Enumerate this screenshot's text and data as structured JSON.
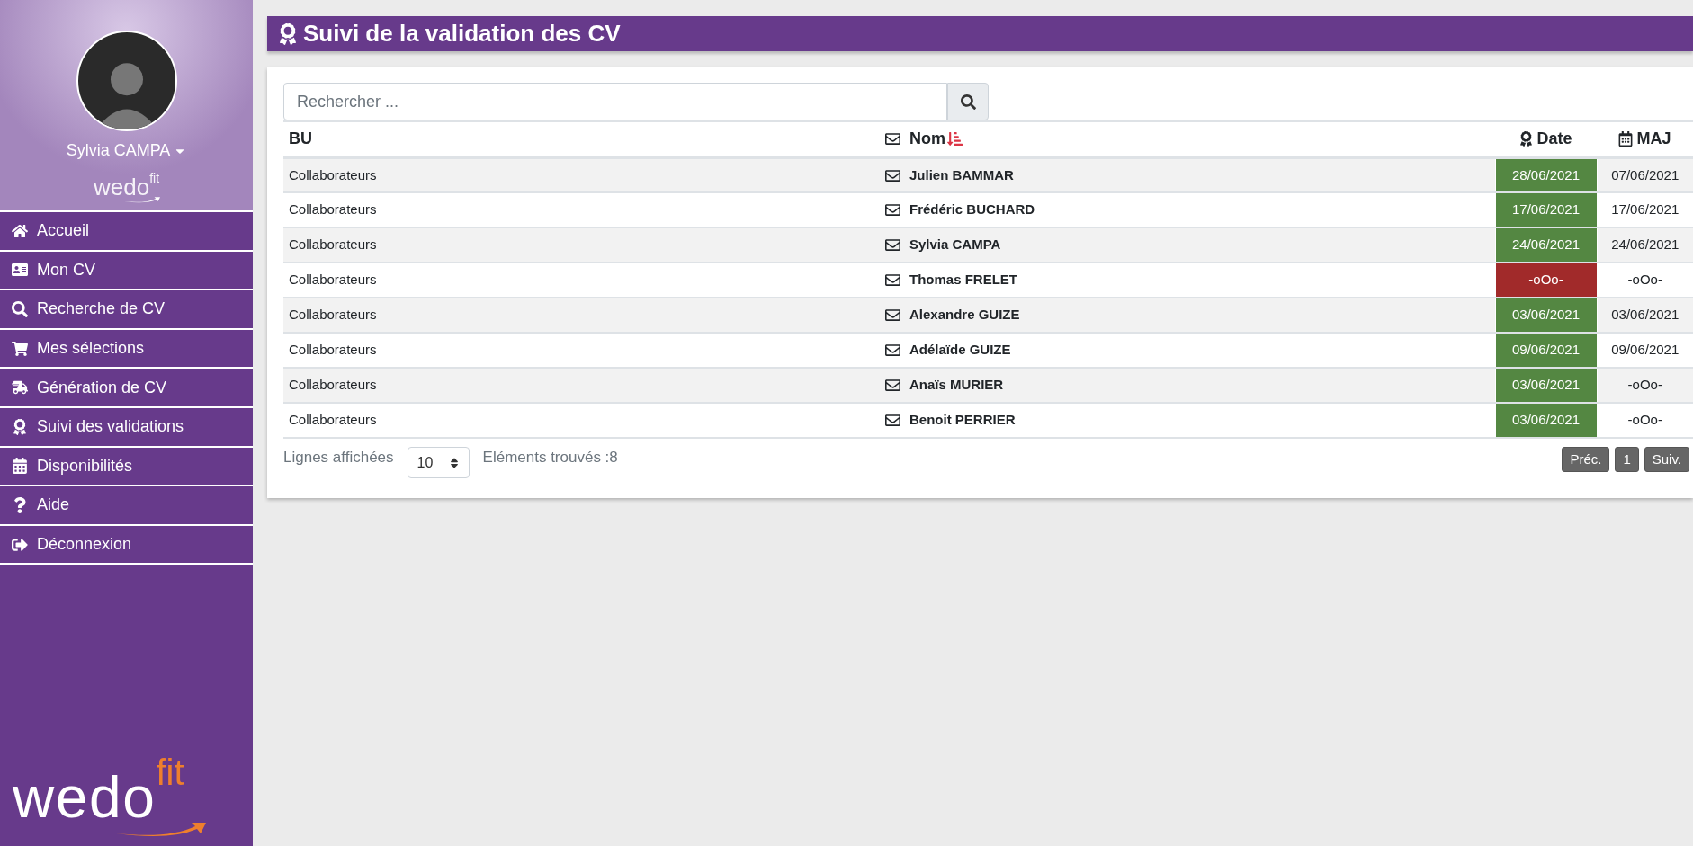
{
  "sidebar": {
    "user": {
      "name": "Sylvia CAMPA"
    },
    "logo_small": {
      "main": "wedo",
      "accent": "fit"
    },
    "items": [
      {
        "label": "Accueil"
      },
      {
        "label": "Mon CV"
      },
      {
        "label": "Recherche de CV"
      },
      {
        "label": "Mes sélections"
      },
      {
        "label": "Génération de CV"
      },
      {
        "label": "Suivi des validations"
      },
      {
        "label": "Disponibilités"
      },
      {
        "label": "Aide"
      },
      {
        "label": "Déconnexion"
      }
    ],
    "logo_large": {
      "main": "wedo",
      "accent": "fit"
    }
  },
  "page": {
    "title": "Suivi de la validation des CV"
  },
  "search": {
    "placeholder": "Rechercher ..."
  },
  "table": {
    "columns": [
      "BU",
      "Nom",
      "Date",
      "MAJ"
    ],
    "rows": [
      {
        "bu": "Collaborateurs",
        "nom": "Julien BAMMAR",
        "date": "28/06/2021",
        "validated": true,
        "maj": "07/06/2021"
      },
      {
        "bu": "Collaborateurs",
        "nom": "Frédéric BUCHARD",
        "date": "17/06/2021",
        "validated": true,
        "maj": "17/06/2021"
      },
      {
        "bu": "Collaborateurs",
        "nom": "Sylvia CAMPA",
        "date": "24/06/2021",
        "validated": true,
        "maj": "24/06/2021"
      },
      {
        "bu": "Collaborateurs",
        "nom": "Thomas FRELET",
        "date": "-oOo-",
        "validated": false,
        "maj": "-oOo-"
      },
      {
        "bu": "Collaborateurs",
        "nom": "Alexandre GUIZE",
        "date": "03/06/2021",
        "validated": true,
        "maj": "03/06/2021"
      },
      {
        "bu": "Collaborateurs",
        "nom": "Adélaïde GUIZE",
        "date": "09/06/2021",
        "validated": true,
        "maj": "09/06/2021"
      },
      {
        "bu": "Collaborateurs",
        "nom": "Anaïs MURIER",
        "date": "03/06/2021",
        "validated": true,
        "maj": "-oOo-"
      },
      {
        "bu": "Collaborateurs",
        "nom": "Benoit PERRIER",
        "date": "03/06/2021",
        "validated": true,
        "maj": "-oOo-"
      }
    ]
  },
  "footer": {
    "rows_label": "Lignes affichées",
    "rows_value": "10",
    "found": "Eléments trouvés :8",
    "pagination": [
      {
        "label": "Préc."
      },
      {
        "label": "1"
      },
      {
        "label": "Suiv."
      }
    ]
  }
}
